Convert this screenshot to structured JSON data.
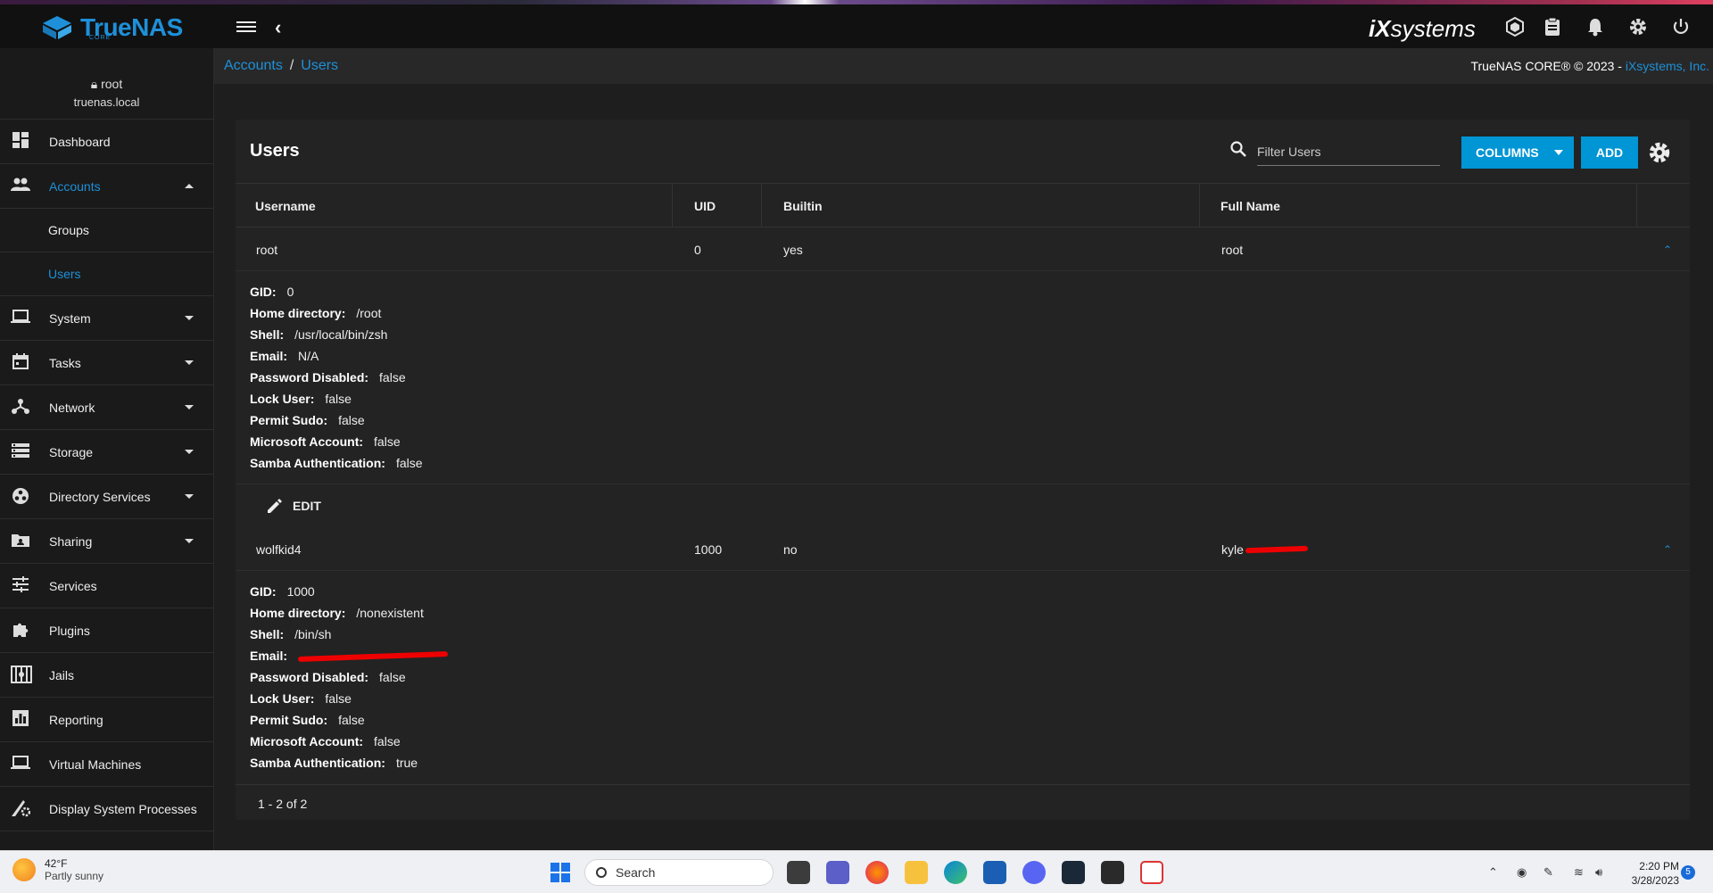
{
  "header": {
    "logo_text": "TrueNAS",
    "logo_sub": "CORE",
    "vendor": "systems",
    "vendor_prefix": "iX"
  },
  "breadcrumb": {
    "parent": "Accounts",
    "separator": "/",
    "current": "Users"
  },
  "copyright": {
    "text": "TrueNAS CORE® © 2023 - ",
    "link": "iXsystems, Inc."
  },
  "sidebar": {
    "user": "root",
    "host": "truenas.local",
    "items": [
      {
        "label": "Dashboard"
      },
      {
        "label": "Accounts"
      },
      {
        "label": "Groups"
      },
      {
        "label": "Users"
      },
      {
        "label": "System"
      },
      {
        "label": "Tasks"
      },
      {
        "label": "Network"
      },
      {
        "label": "Storage"
      },
      {
        "label": "Directory Services"
      },
      {
        "label": "Sharing"
      },
      {
        "label": "Services"
      },
      {
        "label": "Plugins"
      },
      {
        "label": "Jails"
      },
      {
        "label": "Reporting"
      },
      {
        "label": "Virtual Machines"
      },
      {
        "label": "Display System Processes"
      }
    ]
  },
  "card": {
    "title": "Users",
    "filter_placeholder": "Filter Users",
    "columns_label": "COLUMNS",
    "add_label": "ADD",
    "headers": [
      "Username",
      "UID",
      "Builtin",
      "Full Name"
    ],
    "rows": [
      {
        "username": "root",
        "uid": "0",
        "builtin": "yes",
        "full_name": "root",
        "details": [
          {
            "k": "GID:",
            "v": "0"
          },
          {
            "k": "Home directory:",
            "v": "/root"
          },
          {
            "k": "Shell:",
            "v": "/usr/local/bin/zsh"
          },
          {
            "k": "Email:",
            "v": "N/A"
          },
          {
            "k": "Password Disabled:",
            "v": "false"
          },
          {
            "k": "Lock User:",
            "v": "false"
          },
          {
            "k": "Permit Sudo:",
            "v": "false"
          },
          {
            "k": "Microsoft Account:",
            "v": "false"
          },
          {
            "k": "Samba Authentication:",
            "v": "false"
          }
        ]
      },
      {
        "username": "wolfkid4",
        "uid": "1000",
        "builtin": "no",
        "full_name": "kyle",
        "details": [
          {
            "k": "GID:",
            "v": "1000"
          },
          {
            "k": "Home directory:",
            "v": "/nonexistent"
          },
          {
            "k": "Shell:",
            "v": "/bin/sh"
          },
          {
            "k": "Email:",
            "v": ""
          },
          {
            "k": "Password Disabled:",
            "v": "false"
          },
          {
            "k": "Lock User:",
            "v": "false"
          },
          {
            "k": "Permit Sudo:",
            "v": "false"
          },
          {
            "k": "Microsoft Account:",
            "v": "false"
          },
          {
            "k": "Samba Authentication:",
            "v": "true"
          }
        ]
      }
    ],
    "edit_label": "EDIT",
    "pager": "1 - 2 of 2"
  },
  "taskbar": {
    "temp": "42°F",
    "weather": "Partly sunny",
    "search": "Search",
    "time": "2:20 PM",
    "date": "3/28/2023",
    "notif_count": "5"
  },
  "colors": {
    "accent": "#0095d5",
    "link": "#1e90d9",
    "background": "#1e1e1e"
  }
}
